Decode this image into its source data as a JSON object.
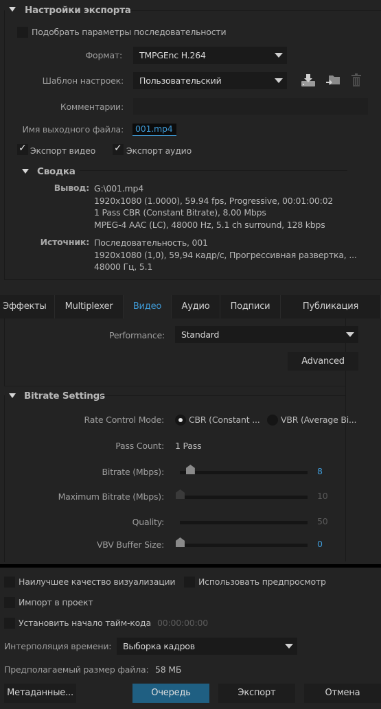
{
  "export_settings": {
    "title": "Настройки экспорта",
    "match_sequence_label": "Подобрать параметры последовательности",
    "match_sequence_checked": false,
    "format_label": "Формат:",
    "format_value": "TMPGEnc H.264",
    "preset_label": "Шаблон настроек:",
    "preset_value": "Пользовательский",
    "preset_icons": [
      "save-preset-icon",
      "import-preset-icon",
      "delete-preset-icon"
    ],
    "comments_label": "Комментарии:",
    "comments_value": "",
    "output_name_label": "Имя выходного файла:",
    "output_name_value": "001.mp4",
    "export_video_label": "Экспорт видео",
    "export_video_checked": true,
    "export_audio_label": "Экспорт аудио",
    "export_audio_checked": true
  },
  "summary": {
    "title": "Сводка",
    "output_label": "Вывод:",
    "output_lines": [
      "G:\\001.mp4",
      "1920x1080 (1.0000), 59.94 fps, Progressive, 00:01:00:02",
      "1 Pass CBR (Constant Bitrate), 8.00 Mbps",
      "MPEG-4 AAC (LC), 48000 Hz, 5.1 ch surround, 128 kbps"
    ],
    "source_label": "Источник:",
    "source_lines": [
      "Последовательность, 001",
      "1920x1080 (1,0), 59,94 кадр/с, Прогрессивная развертка, ...",
      "48000 Гц, 5.1"
    ]
  },
  "tabs": [
    {
      "label": "Эффекты",
      "active": false
    },
    {
      "label": "Multiplexer",
      "active": false
    },
    {
      "label": "Видео",
      "active": true
    },
    {
      "label": "Аудио",
      "active": false
    },
    {
      "label": "Подписи",
      "active": false
    },
    {
      "label": "Публикация",
      "active": false
    }
  ],
  "video": {
    "performance_label": "Performance:",
    "performance_value": "Standard",
    "advanced_label": "Advanced"
  },
  "bitrate": {
    "title": "Bitrate Settings",
    "rate_control_label": "Rate Control Mode:",
    "rate_options": [
      {
        "label": "CBR (Constant ...",
        "selected": true
      },
      {
        "label": "VBR (Average Bi...",
        "selected": false
      }
    ],
    "pass_count_label": "Pass Count:",
    "pass_count_value": "1 Pass",
    "sliders": [
      {
        "label": "Bitrate (Mbps):",
        "value": "8",
        "fraction": 0.08,
        "enabled": true,
        "thumb": true
      },
      {
        "label": "Maximum Bitrate (Mbps):",
        "value": "10",
        "fraction": 0.0,
        "enabled": false,
        "thumb": true
      },
      {
        "label": "Quality:",
        "value": "50",
        "fraction": 0.0,
        "enabled": false,
        "thumb": false
      },
      {
        "label": "VBV Buffer Size:",
        "value": "0",
        "fraction": 0.0,
        "enabled": true,
        "thumb": true
      }
    ]
  },
  "bottom": {
    "best_quality_label": "Наилучшее качество визуализации",
    "best_quality_checked": false,
    "use_previews_label": "Использовать предпросмотр",
    "use_previews_checked": false,
    "import_label": "Импорт в проект",
    "import_checked": false,
    "timecode_label": "Установить начало тайм-кода",
    "timecode_checked": false,
    "timecode_value": "00:00:00:00",
    "interp_label": "Интерполяция времени:",
    "interp_value": "Выборка кадров",
    "filesize_label": "Предполагаемый размер файла:",
    "filesize_value": "58 МБ",
    "metadata_label": "Метаданные...",
    "queue_label": "Очередь",
    "export_label": "Экспорт",
    "cancel_label": "Отмена"
  },
  "colors": {
    "accent": "#3f9ad6",
    "primary_button": "#1f5f82",
    "background": "#232323"
  }
}
